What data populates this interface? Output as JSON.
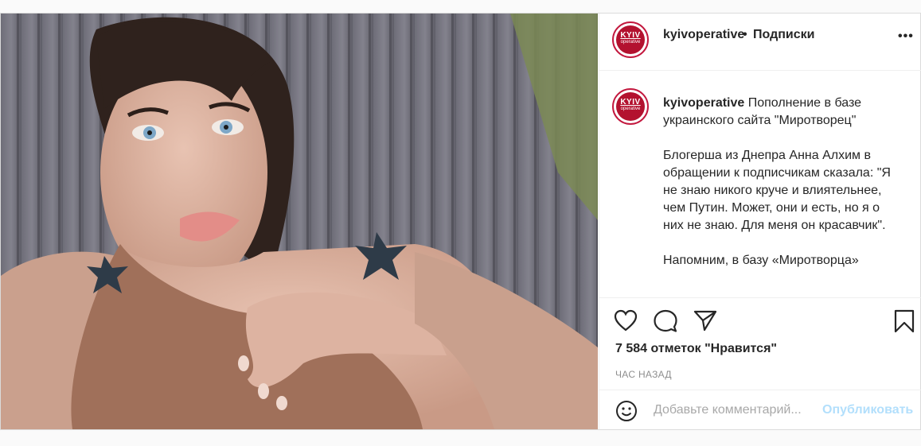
{
  "account": {
    "username": "kyivoperative",
    "avatar_text_main": "KYIV",
    "avatar_text_sub": "operative",
    "follow_separator": "•",
    "follow_label": "Подписки",
    "more_icon": "more-options-icon"
  },
  "caption": {
    "username": "kyivoperative",
    "text": " Пополнение в базе украинского сайта \"Миротворец\"\n\nБлогерша из Днепра Анна Алхим в обращении к подписчикам сказала: \"Я не знаю никого круче и влиятельнее, чем Путин. Может, они и есть, но я о них не знаю. Для меня он красавчик\".\n\nНапомним, в базу «Миротворца»"
  },
  "actions": {
    "like_icon": "heart-icon",
    "comment_icon": "comment-icon",
    "share_icon": "share-icon",
    "save_icon": "bookmark-icon"
  },
  "likes": "7 584 отметок \"Нравится\"",
  "timestamp": "ЧАС НАЗАД",
  "comment_box": {
    "emoji_icon": "emoji-icon",
    "placeholder": "Добавьте комментарий...",
    "publish_label": "Опубликовать"
  },
  "colors": {
    "brand_red": "#b3122f",
    "link_blue_disabled": "#b2dffc",
    "muted_text": "#8e8e8e"
  }
}
